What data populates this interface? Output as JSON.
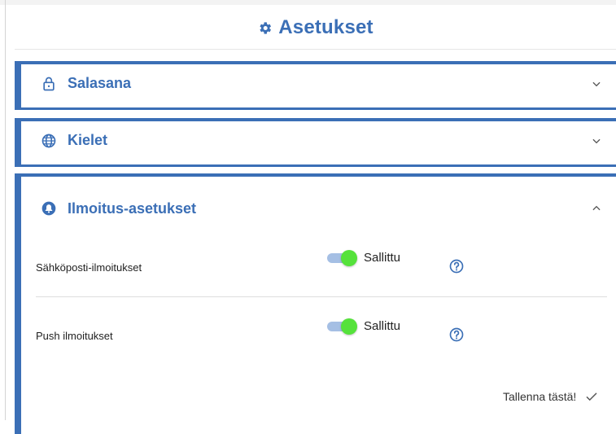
{
  "page": {
    "title": "Asetukset",
    "title_icon": "gear-icon",
    "accent": "#3b6fb6",
    "toggle_on": "#55e23b"
  },
  "sections": [
    {
      "label": "Salasana",
      "icon": "lock-icon",
      "expanded": false
    },
    {
      "label": "Kielet",
      "icon": "globe-icon",
      "expanded": false
    },
    {
      "label": "Ilmoitus-asetukset",
      "icon": "bell-icon",
      "expanded": true
    }
  ],
  "notifications": {
    "rows": [
      {
        "label": "Sähköposti-ilmoitukset",
        "state": "Sallittu",
        "enabled": true
      },
      {
        "label": "Push ilmoitukset",
        "state": "Sallittu",
        "enabled": true
      }
    ],
    "save_label": "Tallenna tästä!"
  }
}
